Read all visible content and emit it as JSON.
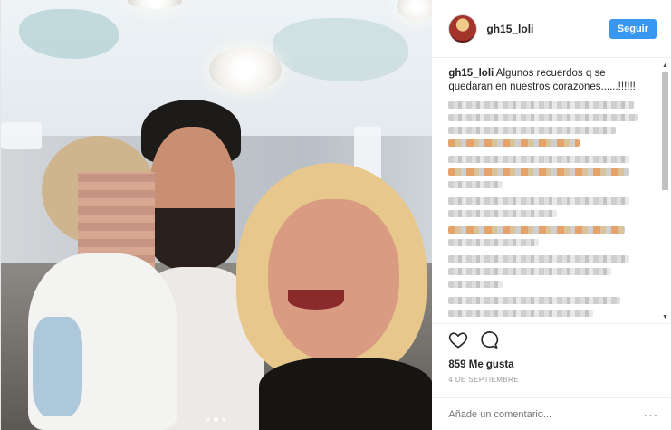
{
  "post": {
    "username": "gh15_loli",
    "follow_label": "Seguir",
    "caption_user": "gh15_loli",
    "caption_text": "Algunos recuerdos q se quedaran en nuestros corazones......!!!!!!",
    "likes": "859 Me gusta",
    "date": "4 DE SEPTIEMBRE",
    "comment_placeholder": "Añade un comentario...",
    "more_label": "···",
    "photo_dots": 3,
    "active_dot": 1
  },
  "icons": {
    "like": "heart-icon",
    "comment": "comment-icon",
    "scroll_up": "scroll-up-arrow-icon",
    "scroll_down": "scroll-down-arrow-icon"
  },
  "colors": {
    "follow_button": "#3897f0",
    "text": "#262626",
    "muted": "#999999"
  }
}
